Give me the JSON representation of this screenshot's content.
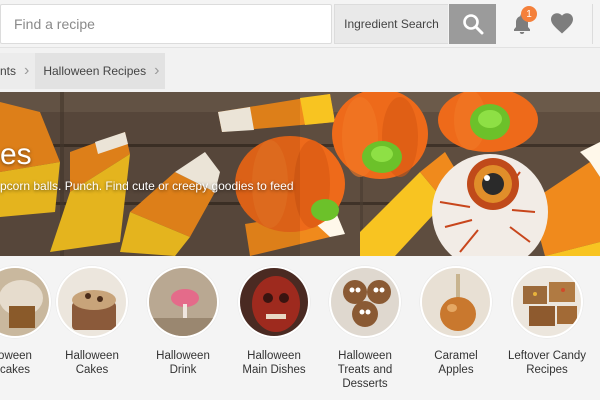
{
  "header": {
    "search_placeholder": "Find a recipe",
    "ingredient_search_label": "Ingredient Search",
    "notification_count": "1"
  },
  "breadcrumb": [
    {
      "label": "nts"
    },
    {
      "label": "Halloween Recipes"
    }
  ],
  "hero": {
    "title": "es",
    "description": "pcorn balls. Punch. Find cute or creepy goodies to feed"
  },
  "categories": [
    {
      "label": "oween\ncakes",
      "icon": "cupcake"
    },
    {
      "label": "Halloween\nCakes",
      "icon": "cake"
    },
    {
      "label": "Halloween\nDrink",
      "icon": "drink"
    },
    {
      "label": "Halloween\nMain Dishes",
      "icon": "main-dish"
    },
    {
      "label": "Halloween\nTreats and\nDesserts",
      "icon": "spider-cookies"
    },
    {
      "label": "Caramel\nApples",
      "icon": "caramel-apple"
    },
    {
      "label": "Leftover Candy\nRecipes",
      "icon": "candy-bars"
    }
  ],
  "colors": {
    "badge": "#f4803b",
    "search_button": "#9b9b9b",
    "candy_orange": "#f08a1c",
    "candy_yellow": "#f8c421",
    "pumpkin": "#ee6a1a",
    "pumpkin_stem": "#6cc12a"
  }
}
